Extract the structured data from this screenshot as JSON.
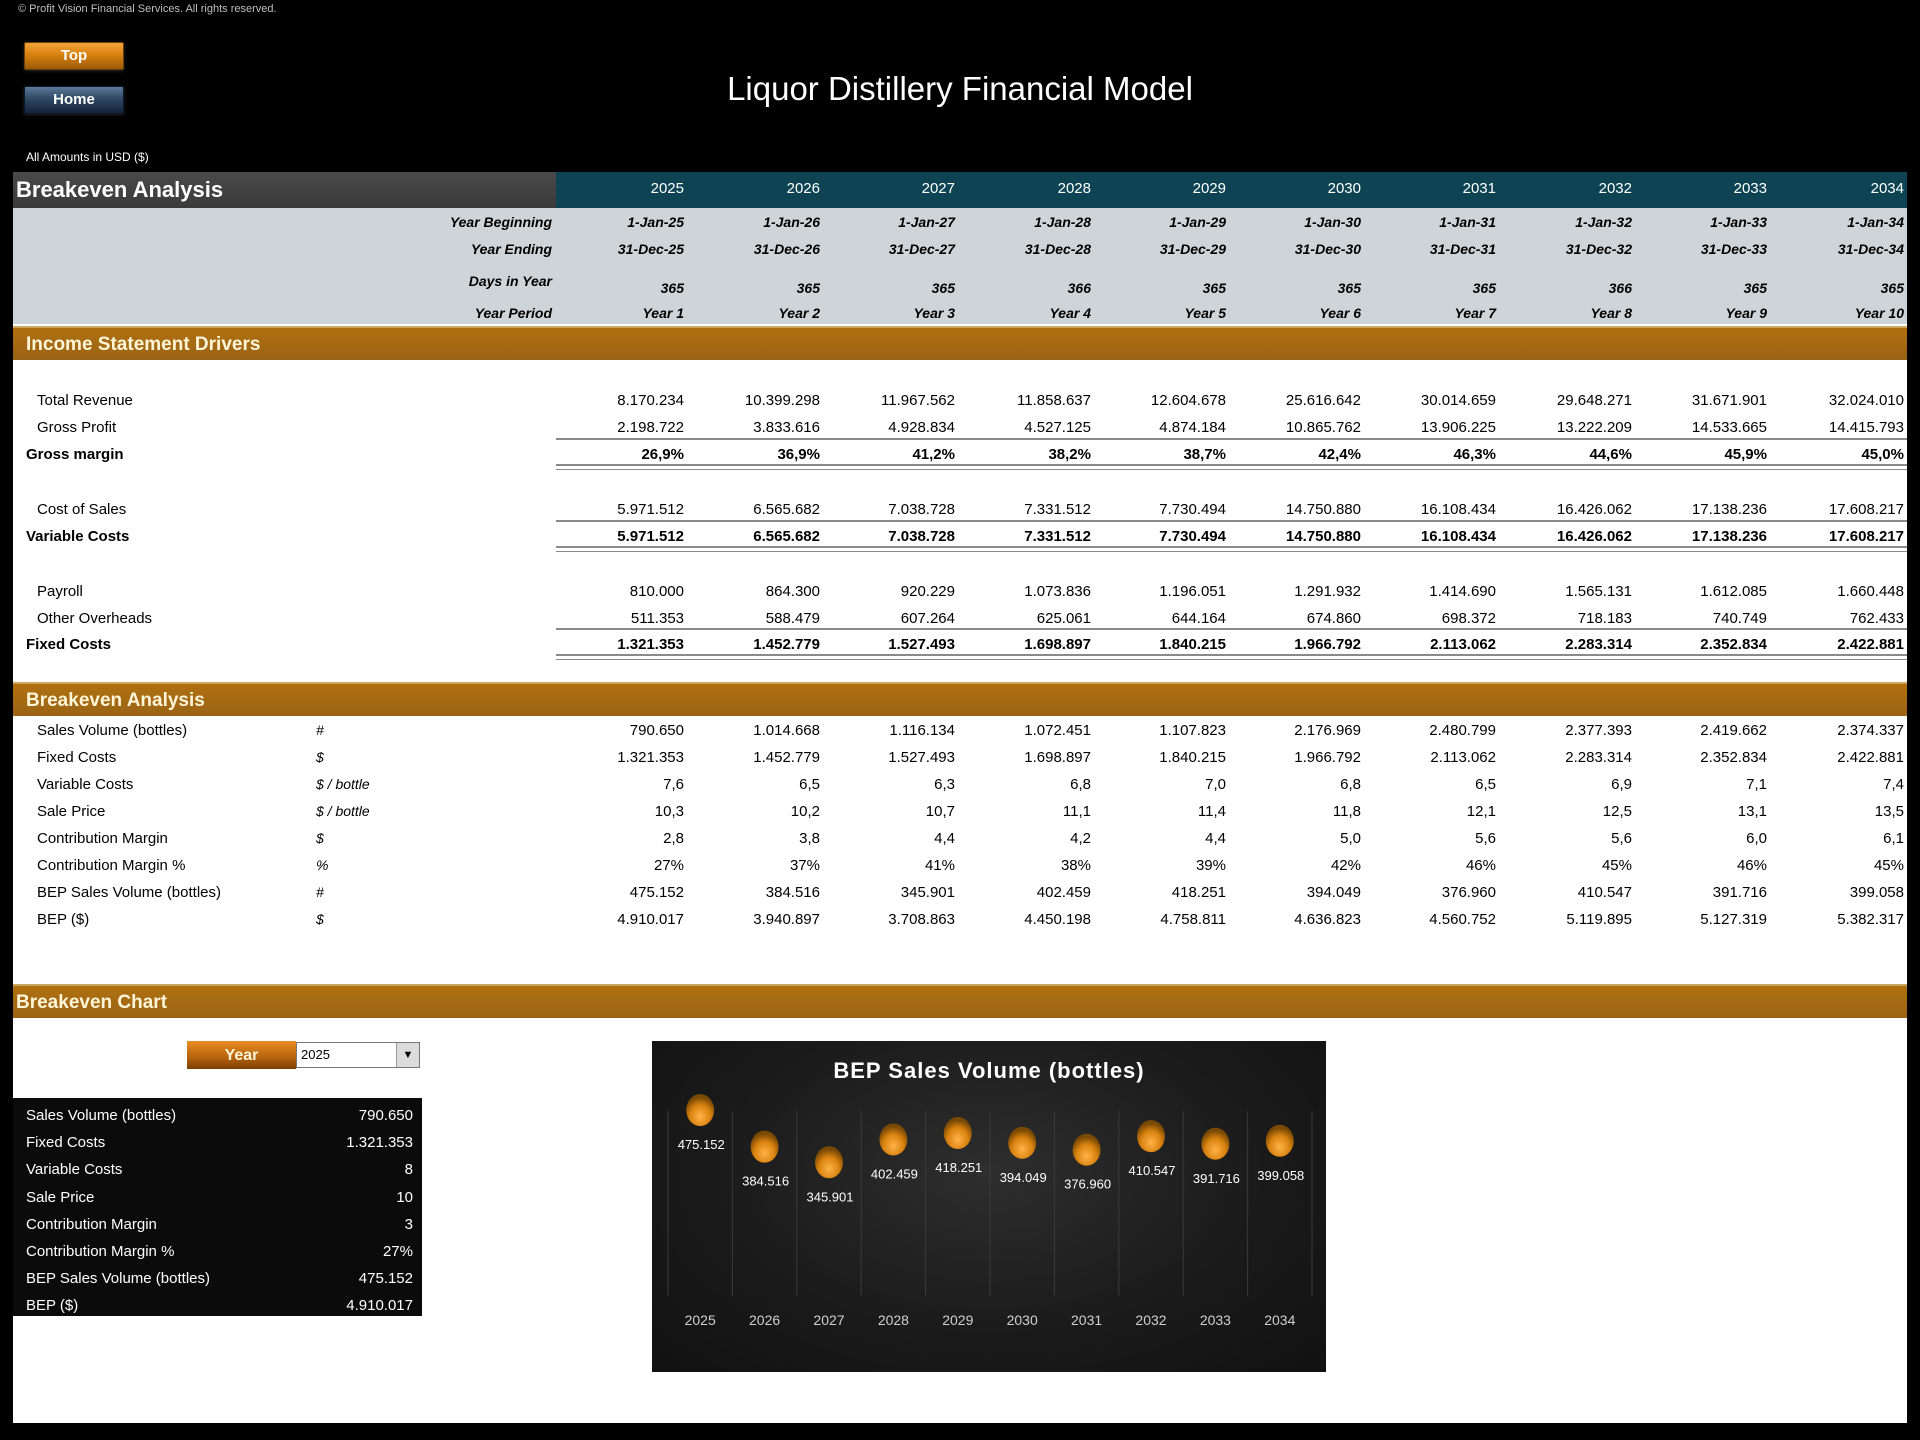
{
  "copyright": "© Profit Vision Financial Services. All rights reserved.",
  "nav": {
    "top_label": "Top",
    "home_label": "Home"
  },
  "title": "Liquor Distillery Financial Model",
  "amounts_note": "All Amounts in  USD ($)",
  "header": {
    "section_title": "Breakeven Analysis",
    "years": [
      "2025",
      "2026",
      "2027",
      "2028",
      "2029",
      "2030",
      "2031",
      "2032",
      "2033",
      "2034"
    ],
    "period_rows": [
      {
        "label": "Year Beginning",
        "values": [
          "1-Jan-25",
          "1-Jan-26",
          "1-Jan-27",
          "1-Jan-28",
          "1-Jan-29",
          "1-Jan-30",
          "1-Jan-31",
          "1-Jan-32",
          "1-Jan-33",
          "1-Jan-34"
        ]
      },
      {
        "label": "Year Ending",
        "values": [
          "31-Dec-25",
          "31-Dec-26",
          "31-Dec-27",
          "31-Dec-28",
          "31-Dec-29",
          "31-Dec-30",
          "31-Dec-31",
          "31-Dec-32",
          "31-Dec-33",
          "31-Dec-34"
        ]
      },
      {
        "label": "Days in Year",
        "values": [
          "365",
          "365",
          "365",
          "366",
          "365",
          "365",
          "365",
          "366",
          "365",
          "365"
        ]
      },
      {
        "label": "Year Period",
        "values": [
          "Year 1",
          "Year 2",
          "Year 3",
          "Year 4",
          "Year 5",
          "Year 6",
          "Year 7",
          "Year 8",
          "Year 9",
          "Year 10"
        ]
      }
    ]
  },
  "income_drivers": {
    "title": "Income Statement Drivers",
    "rows": [
      {
        "label": "Total Revenue",
        "values": [
          "8.170.234",
          "10.399.298",
          "11.967.562",
          "11.858.637",
          "12.604.678",
          "25.616.642",
          "30.014.659",
          "29.648.271",
          "31.671.901",
          "32.024.010"
        ]
      },
      {
        "label": "Gross Profit",
        "values": [
          "2.198.722",
          "3.833.616",
          "4.928.834",
          "4.527.125",
          "4.874.184",
          "10.865.762",
          "13.906.225",
          "13.222.209",
          "14.533.665",
          "14.415.793"
        ]
      },
      {
        "label": "Gross margin",
        "values": [
          "26,9%",
          "36,9%",
          "41,2%",
          "38,2%",
          "38,7%",
          "42,4%",
          "46,3%",
          "44,6%",
          "45,9%",
          "45,0%"
        ]
      },
      {
        "label": "Cost of Sales",
        "values": [
          "5.971.512",
          "6.565.682",
          "7.038.728",
          "7.331.512",
          "7.730.494",
          "14.750.880",
          "16.108.434",
          "16.426.062",
          "17.138.236",
          "17.608.217"
        ]
      },
      {
        "label": "Variable Costs",
        "values": [
          "5.971.512",
          "6.565.682",
          "7.038.728",
          "7.331.512",
          "7.730.494",
          "14.750.880",
          "16.108.434",
          "16.426.062",
          "17.138.236",
          "17.608.217"
        ]
      },
      {
        "label": "Payroll",
        "values": [
          "810.000",
          "864.300",
          "920.229",
          "1.073.836",
          "1.196.051",
          "1.291.932",
          "1.414.690",
          "1.565.131",
          "1.612.085",
          "1.660.448"
        ]
      },
      {
        "label": "Other Overheads",
        "values": [
          "511.353",
          "588.479",
          "607.264",
          "625.061",
          "644.164",
          "674.860",
          "698.372",
          "718.183",
          "740.749",
          "762.433"
        ]
      },
      {
        "label": "Fixed Costs",
        "values": [
          "1.321.353",
          "1.452.779",
          "1.527.493",
          "1.698.897",
          "1.840.215",
          "1.966.792",
          "2.113.062",
          "2.283.314",
          "2.352.834",
          "2.422.881"
        ]
      }
    ]
  },
  "breakeven": {
    "title": "Breakeven Analysis",
    "rows": [
      {
        "label": "Sales Volume (bottles)",
        "unit": "#",
        "values": [
          "790.650",
          "1.014.668",
          "1.116.134",
          "1.072.451",
          "1.107.823",
          "2.176.969",
          "2.480.799",
          "2.377.393",
          "2.419.662",
          "2.374.337"
        ]
      },
      {
        "label": "Fixed Costs",
        "unit": "$",
        "values": [
          "1.321.353",
          "1.452.779",
          "1.527.493",
          "1.698.897",
          "1.840.215",
          "1.966.792",
          "2.113.062",
          "2.283.314",
          "2.352.834",
          "2.422.881"
        ]
      },
      {
        "label": "Variable Costs",
        "unit": "$ / bottle",
        "values": [
          "7,6",
          "6,5",
          "6,3",
          "6,8",
          "7,0",
          "6,8",
          "6,5",
          "6,9",
          "7,1",
          "7,4"
        ]
      },
      {
        "label": "Sale Price",
        "unit": "$ / bottle",
        "values": [
          "10,3",
          "10,2",
          "10,7",
          "11,1",
          "11,4",
          "11,8",
          "12,1",
          "12,5",
          "13,1",
          "13,5"
        ]
      },
      {
        "label": "Contribution Margin",
        "unit": "$",
        "values": [
          "2,8",
          "3,8",
          "4,4",
          "4,2",
          "4,4",
          "5,0",
          "5,6",
          "5,6",
          "6,0",
          "6,1"
        ]
      },
      {
        "label": "Contribution Margin %",
        "unit": "%",
        "values": [
          "27%",
          "37%",
          "41%",
          "38%",
          "39%",
          "42%",
          "46%",
          "45%",
          "46%",
          "45%"
        ]
      },
      {
        "label": "BEP Sales Volume (bottles)",
        "unit": "#",
        "values": [
          "475.152",
          "384.516",
          "345.901",
          "402.459",
          "418.251",
          "394.049",
          "376.960",
          "410.547",
          "391.716",
          "399.058"
        ]
      },
      {
        "label": "BEP ($)",
        "unit": "$",
        "values": [
          "4.910.017",
          "3.940.897",
          "3.708.863",
          "4.450.198",
          "4.758.811",
          "4.636.823",
          "4.560.752",
          "5.119.895",
          "5.127.319",
          "5.382.317"
        ]
      }
    ]
  },
  "breakeven_chart_section": {
    "title": "Breakeven Chart",
    "year_button_label": "Year",
    "year_selected": "2025",
    "summary": [
      {
        "label": "Sales Volume (bottles)",
        "value": "790.650"
      },
      {
        "label": "Fixed Costs",
        "value": "1.321.353"
      },
      {
        "label": "Variable Costs",
        "value": "8"
      },
      {
        "label": "Sale Price",
        "value": "10"
      },
      {
        "label": "Contribution Margin",
        "value": "3"
      },
      {
        "label": "Contribution Margin %",
        "value": "27%"
      },
      {
        "label": "BEP Sales Volume (bottles)",
        "value": "475.152"
      },
      {
        "label": "BEP ($)",
        "value": "4.910.017"
      }
    ]
  },
  "colors": {
    "year_header": "#0d4353",
    "section_band": "#a66a12",
    "bubble": "#e8901e"
  },
  "chart_data": {
    "type": "scatter",
    "title": "BEP Sales Volume (bottles)",
    "categories": [
      "2025",
      "2026",
      "2027",
      "2028",
      "2029",
      "2030",
      "2031",
      "2032",
      "2033",
      "2034"
    ],
    "values": [
      475152,
      384516,
      345901,
      402459,
      418251,
      394049,
      376960,
      410547,
      391716,
      399058
    ],
    "labels": [
      "475.152",
      "384.516",
      "345.901",
      "402.459",
      "418.251",
      "394.049",
      "376.960",
      "410.547",
      "391.716",
      "399.058"
    ],
    "xlabel": "",
    "ylabel": "",
    "ylim": [
      0,
      510000
    ],
    "grid": "vertical-category-dividers",
    "legend": "none"
  }
}
